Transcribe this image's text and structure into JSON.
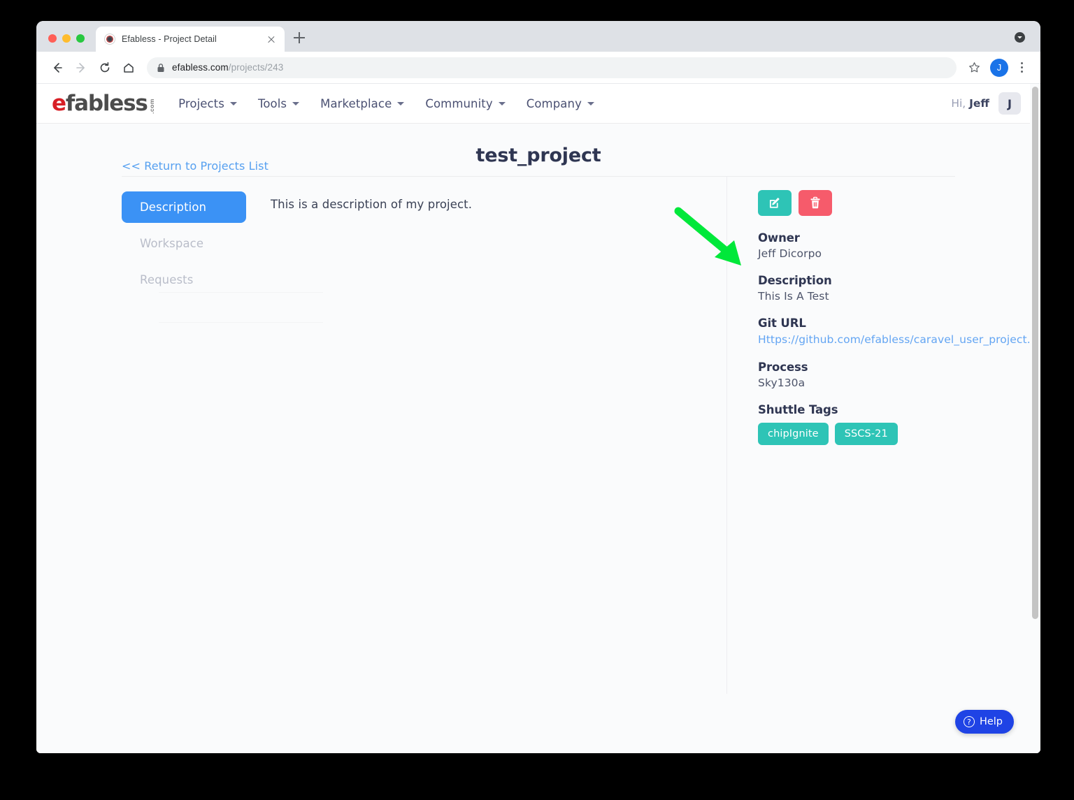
{
  "browser": {
    "tab": {
      "title": "Efabless - Project Detail",
      "favicon": "efabless-favicon"
    },
    "new_tab_label": "+",
    "address": {
      "domain": "efabless.com",
      "path": "/projects/243"
    },
    "profile_initial": "J"
  },
  "site_header": {
    "logo": {
      "e": "e",
      "rest": "fabless",
      "dotcom": ".com"
    },
    "nav": [
      {
        "label": "Projects",
        "has_caret": true
      },
      {
        "label": "Tools",
        "has_caret": true
      },
      {
        "label": "Marketplace",
        "has_caret": true
      },
      {
        "label": "Community",
        "has_caret": true
      },
      {
        "label": "Company",
        "has_caret": true
      }
    ],
    "greeting_prefix": "Hi,",
    "greeting_name": "Jeff",
    "avatar_initial": "J"
  },
  "page": {
    "title": "test_project",
    "return_link": "<< Return to Projects List"
  },
  "tabs": [
    {
      "label": "Description",
      "active": true
    },
    {
      "label": "Workspace",
      "active": false
    },
    {
      "label": "Requests",
      "active": false
    }
  ],
  "description_panel": {
    "text": "This is a description of my project."
  },
  "actions": {
    "edit_label": "Edit project",
    "delete_label": "Delete project",
    "edit_color": "#2ec4b6",
    "delete_color": "#f65b6b"
  },
  "meta": {
    "owner_label": "Owner",
    "owner_value": "Jeff Dicorpo",
    "description_label": "Description",
    "description_value": "This Is A Test",
    "git_url_label": "Git URL",
    "git_url_value": "Https://github.com/efabless/caravel_user_project.git",
    "process_label": "Process",
    "process_value": "Sky130a",
    "shuttle_tags_label": "Shuttle Tags",
    "tags": [
      "chipIgnite",
      "SSCS-21"
    ]
  },
  "help": {
    "label": "Help"
  },
  "annotation": {
    "type": "arrow",
    "color": "#00e83a",
    "points_at": "edit-project-button"
  },
  "colors": {
    "accent_blue": "#3b92f5",
    "link_blue": "#63a5f3",
    "teal": "#2ec4b6",
    "red": "#f65b6b",
    "help_blue": "#1f43e5",
    "logo_red": "#d81f26"
  }
}
